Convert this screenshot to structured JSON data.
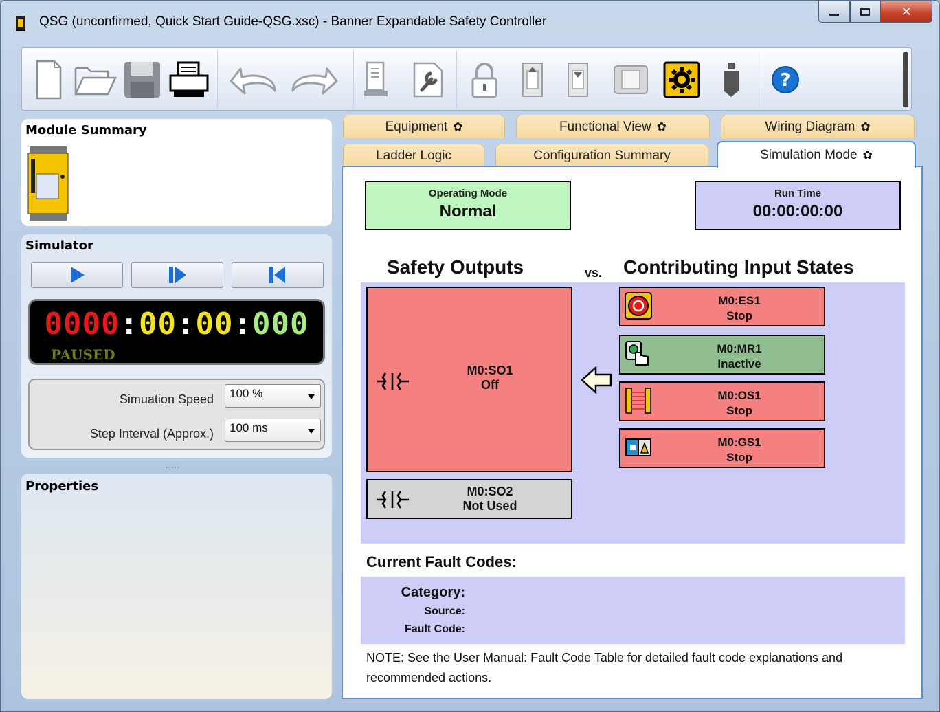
{
  "window": {
    "title": "QSG (unconfirmed, Quick Start Guide-QSG.xsc) - Banner Expandable Safety Controller",
    "controls": [
      "minimize",
      "maximize",
      "close"
    ]
  },
  "toolbar": {
    "icons": [
      "new-file-icon",
      "open-folder-icon",
      "save-icon",
      "print-icon",
      "undo-icon",
      "redo-icon",
      "network-settings-icon",
      "tool-icon",
      "lock-icon",
      "send-config-icon",
      "receive-config-icon",
      "live-mode-icon",
      "simulation-mode-icon",
      "usb-icon",
      "help-icon"
    ]
  },
  "module_summary": {
    "title": "Module Summary"
  },
  "simulator": {
    "title": "Simulator",
    "buttons": [
      "play",
      "step",
      "reset"
    ],
    "clock": {
      "c1": "0000",
      "c2": "00",
      "c3": "00",
      "c4": "000",
      "sep": ":"
    },
    "status": "PAUSED",
    "speed_label": "Simuation Speed",
    "speed_value": "100 %",
    "interval_label": "Step Interval (Approx.)",
    "interval_value": "100 ms"
  },
  "properties": {
    "title": "Properties",
    "splitter": "....."
  },
  "tabs": {
    "equipment": "Equipment",
    "functional_view": "Functional View",
    "wiring_diagram": "Wiring Diagram",
    "ladder_logic": "Ladder Logic",
    "configuration_summary": "Configuration Summary",
    "simulation_mode": "Simulation Mode"
  },
  "main": {
    "operating_mode_caption": "Operating Mode",
    "operating_mode_value": "Normal",
    "run_time_caption": "Run Time",
    "run_time_value": "00:00:00:00",
    "outputs_header": "Safety Outputs",
    "vs": "vs.",
    "inputs_header": "Contributing Input States",
    "outputs": [
      {
        "name": "M0:SO1",
        "state": "Off",
        "color": "#f48080"
      },
      {
        "name": "M0:SO2",
        "state": "Not Used",
        "color": "#d4d4d4"
      }
    ],
    "inputs": [
      {
        "name": "M0:ES1",
        "state": "Stop",
        "icon": "emergency-stop-icon",
        "color": "#f48080"
      },
      {
        "name": "M0:MR1",
        "state": "Inactive",
        "icon": "manual-reset-icon",
        "color": "#90be90"
      },
      {
        "name": "M0:OS1",
        "state": "Stop",
        "icon": "optical-sensor-icon",
        "color": "#f48080"
      },
      {
        "name": "M0:GS1",
        "state": "Stop",
        "icon": "gate-switch-icon",
        "color": "#f48080"
      }
    ],
    "fault": {
      "title": "Current Fault Codes:",
      "category_label": "Category:",
      "source_label": "Source:",
      "code_label": "Fault Code:"
    },
    "note": "NOTE: See the User Manual: Fault Code Table for detailed fault code explanations and recommended actions."
  }
}
